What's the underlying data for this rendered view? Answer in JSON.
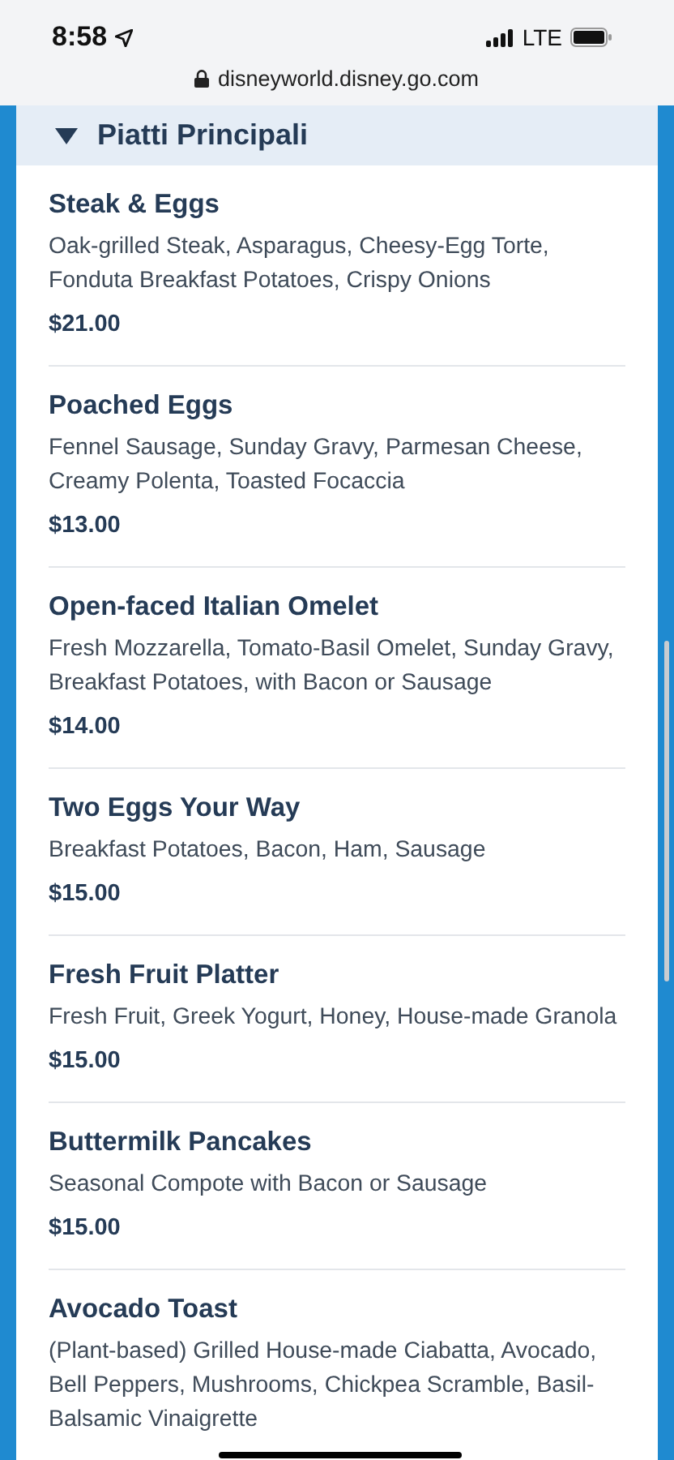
{
  "status_bar": {
    "time": "8:58",
    "network": "LTE"
  },
  "address_bar": {
    "url": "disneyworld.disney.go.com"
  },
  "section": {
    "title": "Piatti Principali",
    "expanded": true,
    "items": [
      {
        "name": "Steak & Eggs",
        "description_lines": [
          "Oak-grilled Steak, Asparagus, Cheesy-Egg Torte,",
          "Fonduta Breakfast Potatoes, Crispy Onions"
        ],
        "price": "$21.00"
      },
      {
        "name": "Poached Eggs",
        "description_lines": [
          "Fennel Sausage, Sunday Gravy, Parmesan Cheese,",
          "Creamy Polenta, Toasted Focaccia"
        ],
        "price": "$13.00"
      },
      {
        "name": "Open-faced Italian Omelet",
        "description_lines": [
          "Fresh Mozzarella, Tomato-Basil Omelet, Sunday Gravy,",
          "Breakfast Potatoes, with Bacon or Sausage"
        ],
        "price": "$14.00"
      },
      {
        "name": "Two Eggs Your Way",
        "description_lines": [
          "Breakfast Potatoes, Bacon, Ham, Sausage"
        ],
        "price": "$15.00"
      },
      {
        "name": "Fresh Fruit Platter",
        "description_lines": [
          "Fresh Fruit, Greek Yogurt, Honey, House-made Granola"
        ],
        "price": "$15.00"
      },
      {
        "name": "Buttermilk Pancakes",
        "description_lines": [
          "Seasonal Compote with Bacon or Sausage"
        ],
        "price": "$15.00"
      },
      {
        "name": "Avocado Toast",
        "description_lines": [
          "(Plant-based) Grilled House-made Ciabatta, Avocado,",
          "Bell Peppers, Mushrooms, Chickpea Scramble, Basil-",
          "Balsamic Vinaigrette"
        ]
      }
    ]
  }
}
